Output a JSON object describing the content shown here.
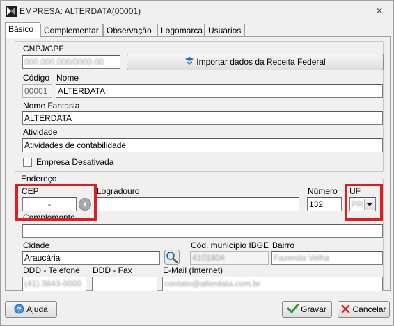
{
  "window": {
    "title": "EMPRESA: ALTERDATA(00001)",
    "close_symbol": "✕"
  },
  "tabs": [
    {
      "label": "Básico",
      "active": true
    },
    {
      "label": "Complementar",
      "active": false
    },
    {
      "label": "Observação",
      "active": false
    },
    {
      "label": "Logomarca",
      "active": false
    },
    {
      "label": "Usuários",
      "active": false
    }
  ],
  "basico": {
    "cnpj_label": "CNPJ/CPF",
    "cnpj_value": "000.000.000/0000-00",
    "import_button": "Importar dados da Receita Federal",
    "codigo_label": "Código",
    "codigo_value": "00001",
    "nome_label": "Nome",
    "nome_value": "ALTERDATA",
    "fantasia_label": "Nome Fantasia",
    "fantasia_value": "ALTERDATA",
    "atividade_label": "Atividade",
    "atividade_value": "Atividades de contabilidade",
    "desativada_label": "Empresa Desativada",
    "desativada_checked": false
  },
  "endereco": {
    "group_label": "Endereço",
    "cep_label": "CEP",
    "cep_value": "-",
    "logradouro_label": "Logradouro",
    "logradouro_value": "",
    "numero_label": "Número",
    "numero_value": "132",
    "uf_label": "UF",
    "uf_value": "PR",
    "complemento_label": "Complemento",
    "complemento_value": "",
    "cidade_label": "Cidade",
    "cidade_value": "Araucária",
    "cod_municipio_label": "Cód. município IBGE",
    "cod_municipio_value": "4101804",
    "bairro_label": "Bairro",
    "bairro_value": "Fazenda Velha",
    "ddd_tel_label": "DDD - Telefone",
    "ddd_tel_value": "(41) 3643-0000",
    "ddd_fax_label": "DDD - Fax",
    "ddd_fax_value": "",
    "email_label": "E-Mail (Internet)",
    "email_value": "contato@alterdata.com.br"
  },
  "footer": {
    "help_button": "Ajuda",
    "save_button": "Gravar",
    "cancel_button": "Cancelar"
  },
  "colors": {
    "highlight": "#e01b22",
    "accent": "#1a6fc0"
  }
}
